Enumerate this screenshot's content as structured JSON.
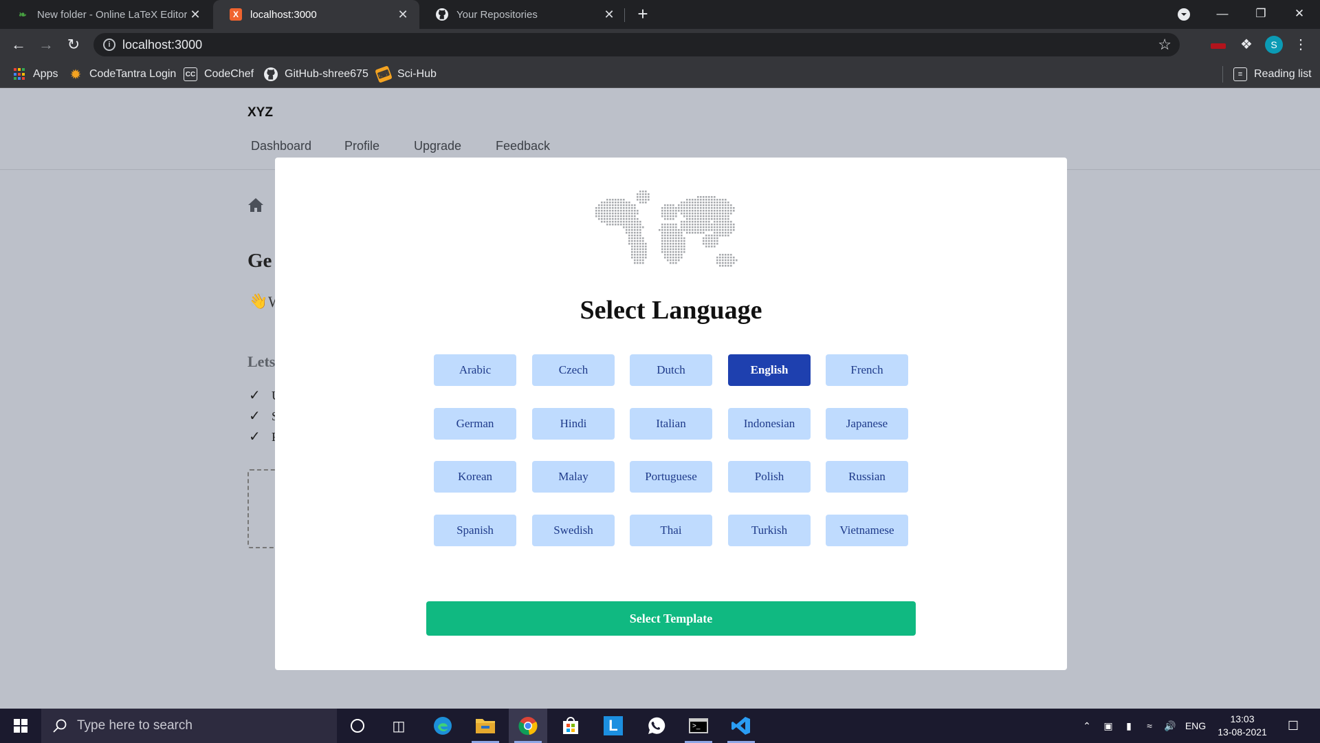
{
  "browser": {
    "tabs": [
      {
        "title": "New folder - Online LaTeX Editor",
        "icon": "overleaf-icon",
        "active": false
      },
      {
        "title": "localhost:3000",
        "icon": "react-app-icon",
        "active": true
      },
      {
        "title": "Your Repositories",
        "icon": "github-icon",
        "active": false
      }
    ],
    "url": "localhost:3000",
    "profile_initial": "S",
    "bookmarks": [
      {
        "label": "Apps",
        "icon": "apps-grid-icon"
      },
      {
        "label": "CodeTantra Login",
        "icon": "codetantra-icon"
      },
      {
        "label": "CodeChef",
        "icon": "codechef-icon"
      },
      {
        "label": "GitHub-shree675",
        "icon": "github-icon"
      },
      {
        "label": "Sci-Hub",
        "icon": "scihub-icon"
      }
    ],
    "reading_list": "Reading list"
  },
  "app": {
    "brand": "XYZ",
    "nav": [
      "Dashboard",
      "Profile",
      "Upgrade",
      "Feedback"
    ],
    "heading_partial": "Ge",
    "wave_partial": "W",
    "lets_partial": "Lets",
    "checklist_partial": [
      "U",
      "S",
      "F"
    ]
  },
  "modal": {
    "title": "Select Language",
    "languages": [
      "Arabic",
      "Czech",
      "Dutch",
      "English",
      "French",
      "German",
      "Hindi",
      "Italian",
      "Indonesian",
      "Japanese",
      "Korean",
      "Malay",
      "Portuguese",
      "Polish",
      "Russian",
      "Spanish",
      "Swedish",
      "Thai",
      "Turkish",
      "Vietnamese"
    ],
    "selected": "English",
    "cta_label": "Select Template",
    "colors": {
      "button_bg": "#bfdbfe",
      "selected_bg": "#1e40af",
      "cta_bg": "#10b981"
    }
  },
  "taskbar": {
    "search_placeholder": "Type here to search",
    "language": "ENG",
    "time": "13:03",
    "date": "13-08-2021"
  }
}
